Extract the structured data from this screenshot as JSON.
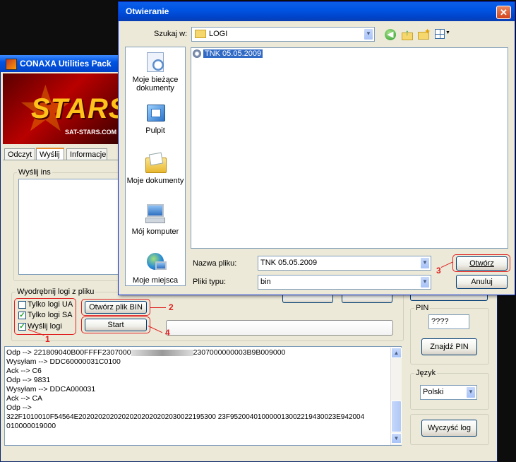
{
  "app": {
    "title": "CONAXA Utilities Pack",
    "banner_logo": "STARS",
    "banner_sub": "SAT-STARS.COM",
    "tabs": [
      "Odczyt",
      "Wyślij",
      "Informacje"
    ],
    "send_ins_group": "Wyślij ins",
    "extract_group": "Wyodrębnij logi z pliku",
    "checkboxes": [
      {
        "label": "Tylko logi UA",
        "checked": false
      },
      {
        "label": "Tylko logi SA",
        "checked": true
      },
      {
        "label": "Wyślij logi",
        "checked": true
      }
    ],
    "open_bin_label": "Otwórz plik BIN",
    "start_label": "Start",
    "pin_group": "PIN",
    "pin_value": "????",
    "find_pin_label": "Znajdź PIN",
    "language_group": "Język",
    "language_value": "Polski",
    "clear_log_label": "Wyczyść log",
    "log_lines": [
      "Odp --> 221809040B00FFFF2307000",
      "2307000000003B9B009000",
      "Wysyłam --> DDC60000031C0100",
      "Ack --> C6",
      "Odp --> 9831",
      "Wysyłam --> DDCA000031",
      "Ack --> CA",
      "Odp -->",
      "322F1010010F54564E20202020202020202020202030022195300 23F952004010000013002219430023E942004",
      "010000019000"
    ]
  },
  "dialog": {
    "title": "Otwieranie",
    "close_symbol": "✕",
    "look_in_label": "Szukaj w:",
    "look_in_value": "LOGI",
    "places": [
      "Moje bieżące dokumenty",
      "Pulpit",
      "Moje dokumenty",
      "Mój komputer",
      "Moje miejsca"
    ],
    "files": [
      "TNK 05.05.2009"
    ],
    "filename_label": "Nazwa pliku:",
    "filename_value": "TNK 05.05.2009",
    "filetype_label": "Pliki typu:",
    "filetype_value": "bin",
    "open_label": "Otwórz",
    "cancel_label": "Anuluj"
  },
  "annotations": [
    "1",
    "2",
    "3",
    "4"
  ],
  "icons": {
    "back": "back-arrow-icon",
    "up": "up-folder-icon",
    "new_folder": "new-folder-icon",
    "views": "views-menu-icon"
  }
}
